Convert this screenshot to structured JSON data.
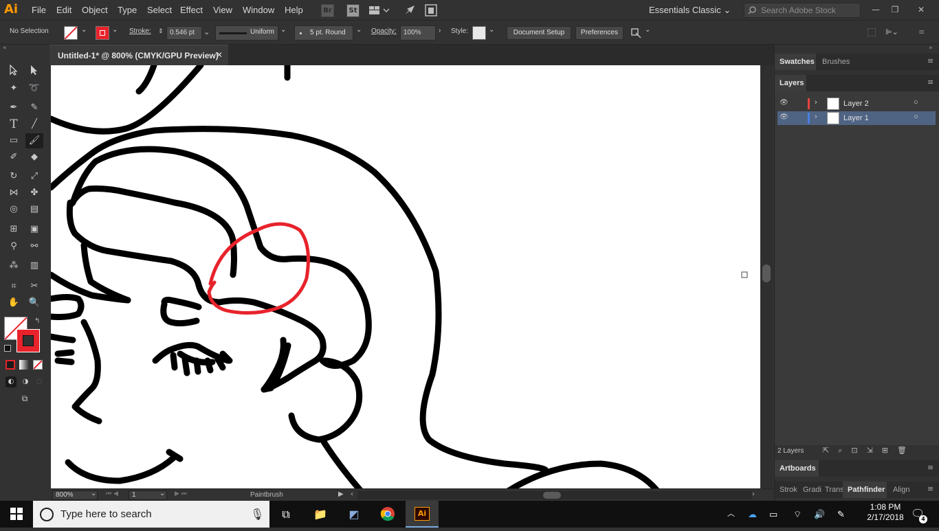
{
  "app": {
    "logo": "Ai"
  },
  "menu": [
    "File",
    "Edit",
    "Object",
    "Type",
    "Select",
    "Effect",
    "View",
    "Window",
    "Help"
  ],
  "bridge_buttons": [
    "Br",
    "St"
  ],
  "workspace": "Essentials Classic",
  "search": {
    "placeholder": "Search Adobe Stock"
  },
  "control": {
    "selection": "No Selection",
    "stroke_label": "Stroke:",
    "stroke_value": "0.546 pt",
    "profile": "Uniform",
    "brush": "5 pt. Round",
    "opacity_label": "Opacity:",
    "opacity_value": "100%",
    "style_label": "Style:",
    "doc_setup": "Document Setup",
    "preferences": "Preferences"
  },
  "document": {
    "tab_title": "Untitled-1* @ 800% (CMYK/GPU Preview)"
  },
  "status": {
    "zoom": "800%",
    "artboard": "1",
    "tool": "Paintbrush"
  },
  "panels": {
    "top_tabs": [
      "Swatches",
      "Brushes"
    ],
    "layers_tab": "Layers",
    "layers": [
      {
        "name": "Layer 2",
        "color": "#e8433f",
        "selected": false
      },
      {
        "name": "Layer 1",
        "color": "#4a7fe0",
        "selected": true
      }
    ],
    "layers_count": "2 Layers",
    "artboards_tab": "Artboards",
    "bottom_tabs": [
      "Strok",
      "Gradi",
      "Trans",
      "Pathfinder",
      "Align"
    ]
  },
  "taskbar": {
    "search_placeholder": "Type here to search",
    "time": "1:08 PM",
    "date": "2/17/2018",
    "notifications": "4"
  },
  "colors": {
    "accent_red": "#e8232b",
    "ai_orange": "#ff9a00"
  }
}
